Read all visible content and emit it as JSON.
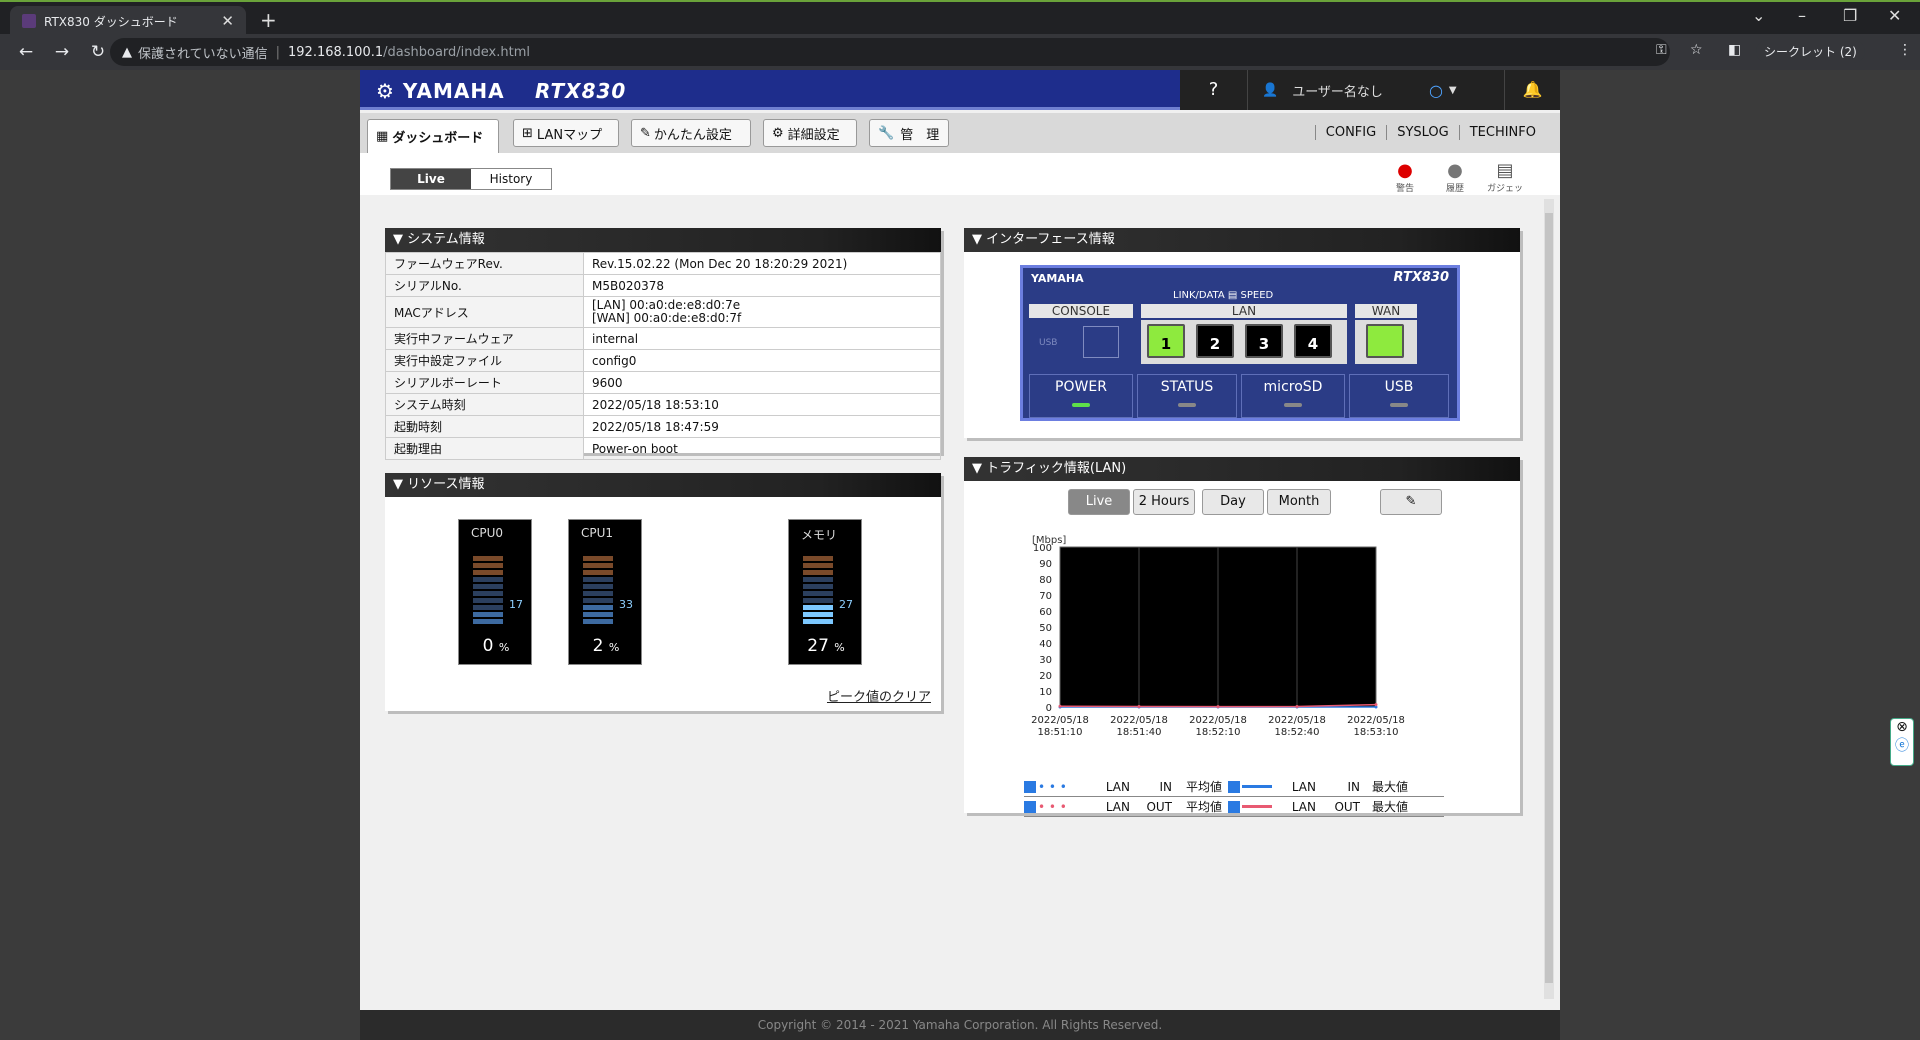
{
  "browser": {
    "tab_title": "RTX830 ダッシュボード",
    "warning": "保護されていない通信",
    "url_host": "192.168.100.1",
    "url_path": "/dashboard/index.html",
    "incognito": "シークレット (2)"
  },
  "header": {
    "logo": "YAMAHA",
    "model": "RTX830",
    "help": "?",
    "user": "ユーザー名なし"
  },
  "menu": {
    "dashboard": "ダッシュボード",
    "lanmap": "LANマップ",
    "easy": "かんたん設定",
    "advanced": "詳細設定",
    "manage": "管　理",
    "config": "CONFIG",
    "syslog": "SYSLOG",
    "techinfo": "TECHINFO"
  },
  "view_toggle": {
    "live": "Live",
    "history": "History"
  },
  "right_icons": {
    "alert": "警告",
    "history": "履歴",
    "gadget": "ガジェット"
  },
  "system_info": {
    "title": "システム情報",
    "rows": [
      {
        "label": "ファームウェアRev.",
        "value": "Rev.15.02.22 (Mon Dec 20 18:20:29 2021)"
      },
      {
        "label": "シリアルNo.",
        "value": "M5B020378"
      },
      {
        "label": "MACアドレス",
        "value": "[LAN] 00:a0:de:e8:d0:7e",
        "value2": "[WAN] 00:a0:de:e8:d0:7f"
      },
      {
        "label": "実行中ファームウェア",
        "value": "internal"
      },
      {
        "label": "実行中設定ファイル",
        "value": "config0"
      },
      {
        "label": "シリアルボーレート",
        "value": "9600"
      },
      {
        "label": "システム時刻",
        "value": "2022/05/18 18:53:10"
      },
      {
        "label": "起動時刻",
        "value": "2022/05/18 18:47:59"
      },
      {
        "label": "起動理由",
        "value": "Power-on boot"
      }
    ]
  },
  "resource_info": {
    "title": "リソース情報",
    "clear": "ピーク値のクリア",
    "gauges": [
      {
        "label": "CPU0",
        "value": "0",
        "peak": "17",
        "unit": "%",
        "level": 0.0
      },
      {
        "label": "CPU1",
        "value": "2",
        "peak": "33",
        "unit": "%",
        "level": 0.02
      },
      {
        "label": "メモリ",
        "value": "27",
        "peak": "27",
        "unit": "%",
        "level": 0.27
      }
    ]
  },
  "interface_info": {
    "title": "インターフェース情報",
    "logo": "YAMAHA",
    "model": "RTX830",
    "console": "CONSOLE",
    "usb_small": "USB",
    "link": "LINK/DATA",
    "speed": "SPEED",
    "lan": "LAN",
    "wan": "WAN",
    "ports": [
      "1",
      "2",
      "3",
      "4"
    ],
    "power": "POWER",
    "status": "STATUS",
    "microsd": "microSD",
    "usb": "USB"
  },
  "traffic": {
    "title": "トラフィック情報(LAN)",
    "buttons": [
      "Live",
      "2 Hours",
      "Day",
      "Month"
    ],
    "edit_icon": "pencil-icon",
    "legend": [
      {
        "a": "LAN",
        "b": "IN",
        "c": "平均値"
      },
      {
        "a": "LAN",
        "b": "IN",
        "c": "最大値"
      },
      {
        "a": "LAN",
        "b": "OUT",
        "c": "平均値"
      },
      {
        "a": "LAN",
        "b": "OUT",
        "c": "最大値"
      }
    ]
  },
  "chart_data": {
    "type": "line",
    "ylabel": "[Mbps]",
    "ylim": [
      0,
      100
    ],
    "yticks": [
      "100",
      "90",
      "80",
      "70",
      "60",
      "50",
      "40",
      "30",
      "20",
      "10",
      "0"
    ],
    "x": [
      "2022/05/18 18:51:10",
      "2022/05/18 18:51:40",
      "2022/05/18 18:52:10",
      "2022/05/18 18:52:40",
      "2022/05/18 18:53:10"
    ],
    "series": [
      {
        "name": "LAN IN",
        "values": [
          0,
          0,
          0,
          0,
          0
        ]
      },
      {
        "name": "LAN OUT",
        "values": [
          0.5,
          0.3,
          0.2,
          0.3,
          1.5
        ]
      }
    ]
  },
  "footer": "Copyright © 2014 - 2021 Yamaha Corporation. All Rights Reserved."
}
